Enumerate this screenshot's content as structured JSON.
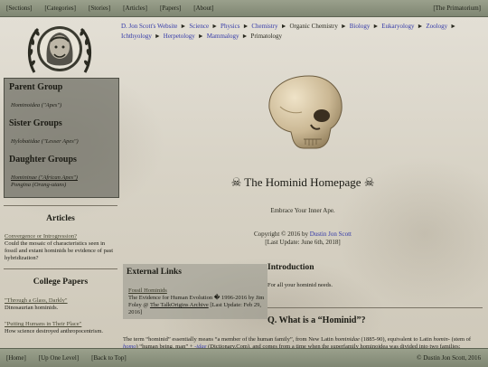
{
  "top_nav": {
    "sections": "[Sections]",
    "categories": "[Categories]",
    "stories": "[Stories]",
    "articles": "[Articles]",
    "papers": "[Papers]",
    "about": "[About]",
    "primatorium": "[The Primatorium]"
  },
  "breadcrumbs": {
    "items": [
      "D. Jon Scott's Website",
      "Science",
      "Physics",
      "Chemistry",
      "Organic Chemistry",
      "Biology",
      "Eukaryology",
      "Zoology",
      "Ichthyology",
      "Herpetology",
      "Mammalogy",
      "Primatology"
    ],
    "separator": "►"
  },
  "sidebar": {
    "parent_title": "Parent Group",
    "parent_item": "Hominoidea (\"Apes\")",
    "sister_title": "Sister Groups",
    "sister_item": "Hylobatidae (\"Lesser Apes\")",
    "daughter_title": "Daughter Groups",
    "daughter_item1": "Homininae (\"African Apes\")",
    "daughter_item2": "Pongina (Orang-utans)",
    "articles_title": "Articles",
    "article_link": "Convergence or Introgression?",
    "article_text": "Could the mosaic of characteristics seen in fossil and extant hominids be evidence of past hybridization?",
    "papers_title": "College Papers",
    "paper1_link": "\"Through a Glass, Darkly\"",
    "paper1_text": "Dinosaurian hominids.",
    "paper2_link": "\"Putting Humans in Their Place\"",
    "paper2_text": "How science destroyed anthropocentrism."
  },
  "main": {
    "title": "☠ The Hominid Homepage ☠",
    "tagline": "Embrace Your Inner Ape.",
    "copyright_prefix": "Copyright © 2016 by",
    "copyright_author": "Dustin Jon Scott",
    "last_update": "[Last Update: June 6th, 2018]"
  },
  "external_links": {
    "title": "External Links",
    "link1": "Fossil Hominids",
    "desc_part1": "The Evidence for Human Evolution � 1996-2016 by Jim Foley @",
    "desc_link": "The TalkOrigins Archive",
    "desc_part2": "[Last Update: Feb 29, 2016]"
  },
  "intro": {
    "title": "Introduction",
    "text": "For all your hominid needs."
  },
  "question": {
    "title": "Q. What is a “Hominid”?",
    "text_a": "The term “hominid” essentially means “a member of the human family”, from New Latin",
    "text_b": "hominidae",
    "text_c": "(1885-90), equivalent to Latin",
    "text_d": "homin-",
    "text_e": "(stem of",
    "text_f": "homo",
    "text_g": ") “human being, man” +",
    "text_h": "-idae",
    "text_i": "(Dictionary.Com), and comes from a time when the superfamily hominoidea was divided into two families:"
  },
  "bottom_nav": {
    "home": "[Home]",
    "up_one_level": "[Up One Level]",
    "back_to_top": "[Back to Top]",
    "copyright": "© Dustin Jon Scott, 2016"
  },
  "colors": {
    "nav_bar": "#8a907c",
    "link": "#3339a8",
    "panel": "#6e6e64"
  }
}
